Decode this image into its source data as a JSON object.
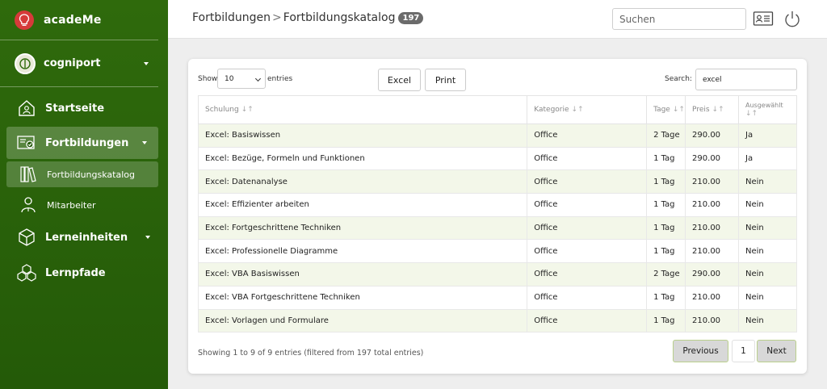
{
  "sidebar": {
    "brand": "acadeMe",
    "org": "cogniport",
    "items": [
      {
        "label": "Startseite",
        "icon": "home-icon"
      },
      {
        "label": "Fortbildungen",
        "icon": "certificate-icon"
      },
      {
        "label": "Fortbildungskatalog",
        "icon": "books-icon"
      },
      {
        "label": "Mitarbeiter",
        "icon": "person-icon"
      },
      {
        "label": "Lerneinheiten",
        "icon": "cube-icon"
      },
      {
        "label": "Lernpfade",
        "icon": "cubes-icon"
      }
    ]
  },
  "header": {
    "crumb1": "Fortbildungen",
    "separator": ">",
    "crumb2": "Fortbildungskatalog",
    "count": "197",
    "search_placeholder": "Suchen"
  },
  "controls": {
    "show_label": "Show",
    "page_length": "10",
    "entries_label": "entries",
    "excel_label": "Excel",
    "print_label": "Print",
    "search_label": "Search:",
    "search_value": "excel"
  },
  "table": {
    "columns": [
      "Schulung",
      "Kategorie",
      "Tage",
      "Preis",
      "Ausgewählt"
    ],
    "rows": [
      [
        "Excel: Basiswissen",
        "Office",
        "2 Tage",
        "290.00",
        "Ja"
      ],
      [
        "Excel: Bezüge, Formeln und Funktionen",
        "Office",
        "1 Tag",
        "290.00",
        "Ja"
      ],
      [
        "Excel: Datenanalyse",
        "Office",
        "1 Tag",
        "210.00",
        "Nein"
      ],
      [
        "Excel: Effizienter arbeiten",
        "Office",
        "1 Tag",
        "210.00",
        "Nein"
      ],
      [
        "Excel: Fortgeschrittene Techniken",
        "Office",
        "1 Tag",
        "210.00",
        "Nein"
      ],
      [
        "Excel: Professionelle Diagramme",
        "Office",
        "1 Tag",
        "210.00",
        "Nein"
      ],
      [
        "Excel: VBA Basiswissen",
        "Office",
        "2 Tage",
        "290.00",
        "Nein"
      ],
      [
        "Excel: VBA Fortgeschrittene Techniken",
        "Office",
        "1 Tag",
        "210.00",
        "Nein"
      ],
      [
        "Excel: Vorlagen und Formulare",
        "Office",
        "1 Tag",
        "210.00",
        "Nein"
      ]
    ]
  },
  "footer": {
    "info": "Showing 1 to 9 of 9 entries (filtered from 197 total entries)",
    "previous": "Previous",
    "page": "1",
    "next": "Next"
  },
  "colors": {
    "sidebar_bg": "#2f6a0c",
    "row_stripe": "#f3f7e9",
    "brand_logo": "#d63a3a"
  }
}
